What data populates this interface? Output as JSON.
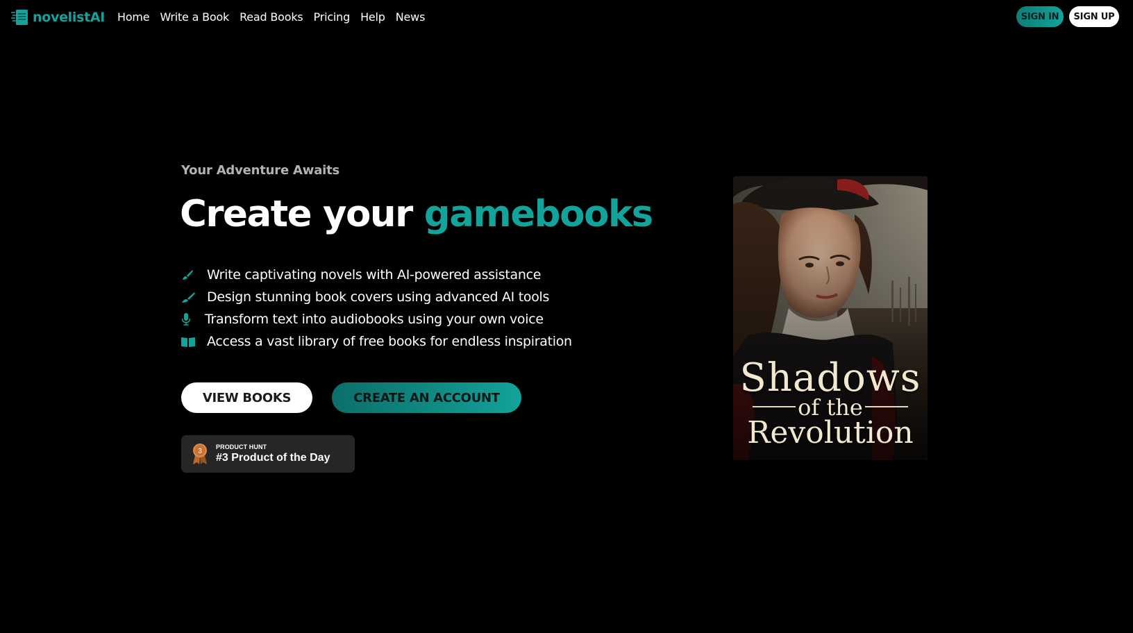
{
  "brand": {
    "name": "novelistAI",
    "logo_icon": "stacked-book-logo-icon",
    "accent_color": "#12a39a"
  },
  "nav": {
    "links": [
      {
        "label": "Home"
      },
      {
        "label": "Write a Book"
      },
      {
        "label": "Read Books"
      },
      {
        "label": "Pricing"
      },
      {
        "label": "Help"
      },
      {
        "label": "News"
      }
    ],
    "sign_in_label": "SIGN IN",
    "sign_up_label": "SIGN UP"
  },
  "hero": {
    "eyebrow": "Your Adventure Awaits",
    "headline_prefix": "Create your",
    "headline_accent": "gamebooks",
    "features": [
      {
        "icon": "paintbrush-icon",
        "text": "Write captivating novels with AI-powered assistance"
      },
      {
        "icon": "paintbrush-icon",
        "text": "Design stunning book covers using advanced AI tools"
      },
      {
        "icon": "microphone-icon",
        "text": "Transform text into audiobooks using your own voice"
      },
      {
        "icon": "open-book-icon",
        "text": "Access a vast library of free books for endless inspiration"
      }
    ],
    "view_books_label": "VIEW BOOKS",
    "create_account_label": "CREATE AN ACCOUNT"
  },
  "product_hunt": {
    "kicker": "PRODUCT HUNT",
    "title": "#3 Product of the Day",
    "medal_icon": "bronze-medal-icon",
    "rank": "3"
  },
  "featured_book": {
    "title_line1": "Shadows",
    "title_line2": "of the",
    "title_line3": "Revolution"
  }
}
